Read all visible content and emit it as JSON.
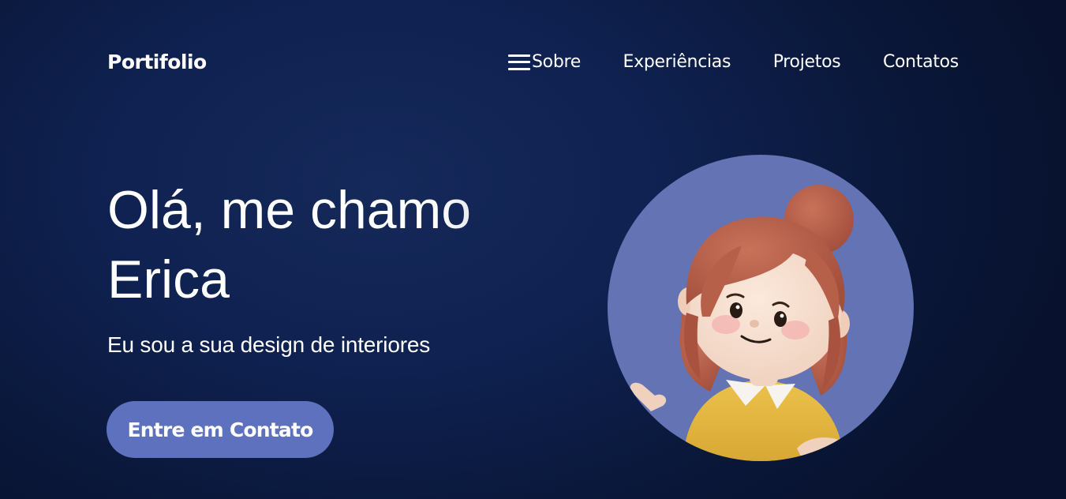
{
  "header": {
    "logo": "Portifolio",
    "nav": [
      {
        "label": "Sobre"
      },
      {
        "label": "Experiências"
      },
      {
        "label": "Projetos"
      },
      {
        "label": "Contatos"
      }
    ],
    "menu_icon": "hamburger-menu-icon"
  },
  "hero": {
    "title_line1": "Olá, me chamo",
    "title_line2": "Erica",
    "subtitle": "Eu sou a sua design de interiores",
    "cta_label": "Entre em Contato",
    "avatar": "cartoon-girl-avatar"
  },
  "colors": {
    "background": "#0f2150",
    "accent": "#5e71be",
    "avatar_circle": "#6373b4",
    "text": "#ffffff"
  }
}
